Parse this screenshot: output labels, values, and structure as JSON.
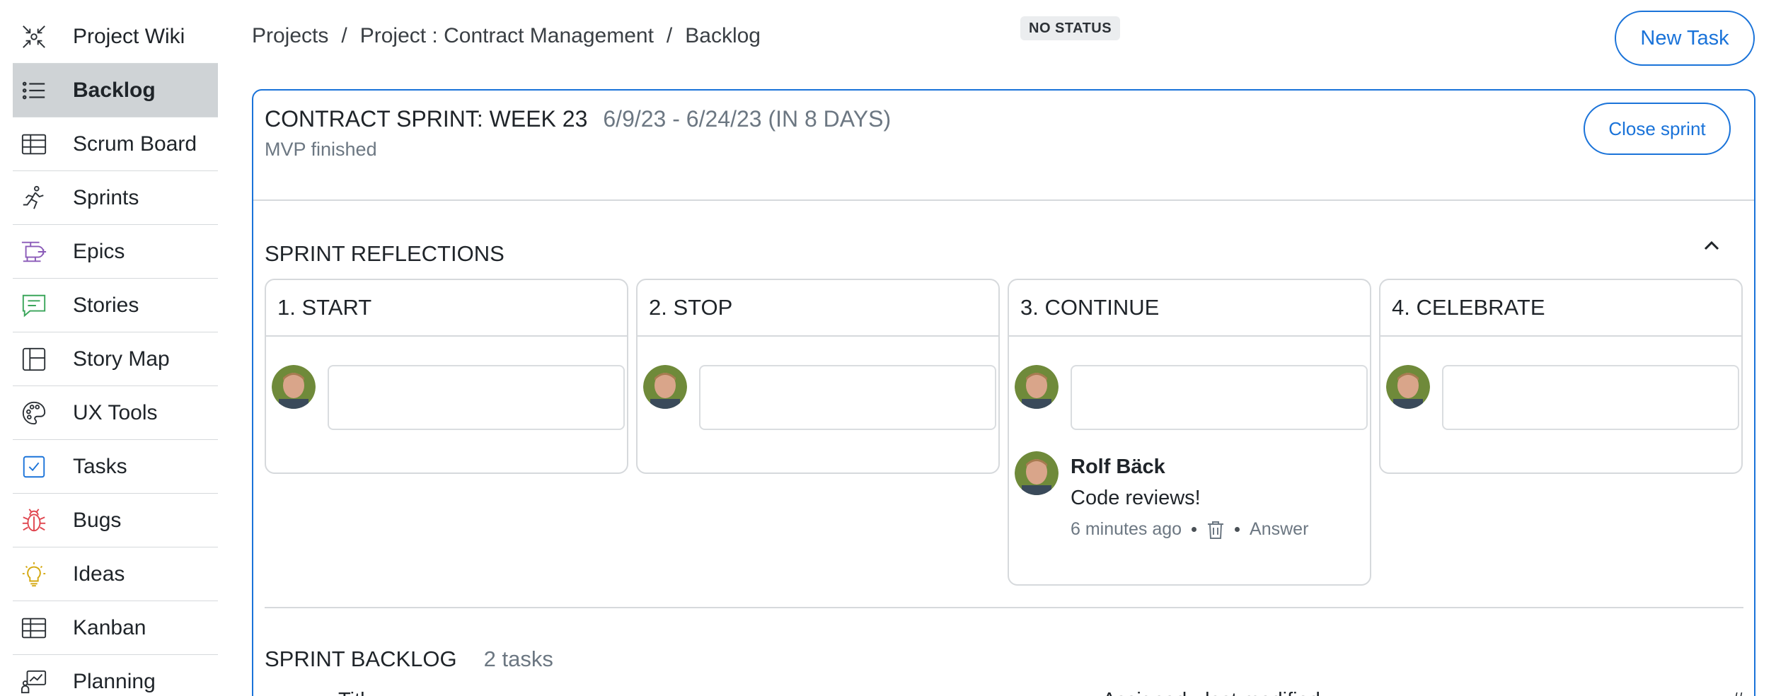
{
  "sidebar": {
    "items": [
      {
        "label": "Project Wiki",
        "icon": "shrink-arrows-icon",
        "active": false
      },
      {
        "label": "Backlog",
        "icon": "list-icon",
        "active": true
      },
      {
        "label": "Scrum Board",
        "icon": "table-grid-icon",
        "active": false
      },
      {
        "label": "Sprints",
        "icon": "running-person-icon",
        "active": false
      },
      {
        "label": "Epics",
        "icon": "helicopter-icon",
        "active": false
      },
      {
        "label": "Stories",
        "icon": "chat-bubble-icon",
        "active": false
      },
      {
        "label": "Story Map",
        "icon": "layout-panel-icon",
        "active": false
      },
      {
        "label": "UX Tools",
        "icon": "palette-icon",
        "active": false
      },
      {
        "label": "Tasks",
        "icon": "checkbox-icon",
        "active": false
      },
      {
        "label": "Bugs",
        "icon": "bug-icon",
        "active": false
      },
      {
        "label": "Ideas",
        "icon": "lightbulb-icon",
        "active": false
      },
      {
        "label": "Kanban",
        "icon": "kanban-grid-icon",
        "active": false
      },
      {
        "label": "Planning",
        "icon": "chart-presentation-icon",
        "active": false
      }
    ]
  },
  "breadcrumb": {
    "items": [
      "Projects",
      "Project : Contract Management",
      "Backlog"
    ],
    "separator": "/"
  },
  "status_badge": "NO STATUS",
  "new_task_label": "New Task",
  "sprint": {
    "title": "CONTRACT SPRINT: WEEK 23",
    "dates": "6/9/23 - 6/24/23 (IN 8 DAYS)",
    "goal": "MVP finished",
    "close_label": "Close sprint"
  },
  "reflections": {
    "title": "SPRINT REFLECTIONS",
    "columns": [
      {
        "label": "1. START"
      },
      {
        "label": "2. STOP"
      },
      {
        "label": "3. CONTINUE"
      },
      {
        "label": "4. CELEBRATE"
      }
    ],
    "comment": {
      "author": "Rolf Bäck",
      "text": "Code reviews!",
      "time": "6 minutes ago",
      "answer_label": "Answer"
    }
  },
  "backlog": {
    "title": "SPRINT BACKLOG",
    "count": "2 tasks",
    "headers": [
      "Titl",
      "Assigned  ·  last modified",
      "#"
    ]
  },
  "colors": {
    "accent": "#1a73d9",
    "active_bg": "#cfd3d6",
    "muted_text": "#6c7782",
    "border": "#d6d9dc"
  }
}
